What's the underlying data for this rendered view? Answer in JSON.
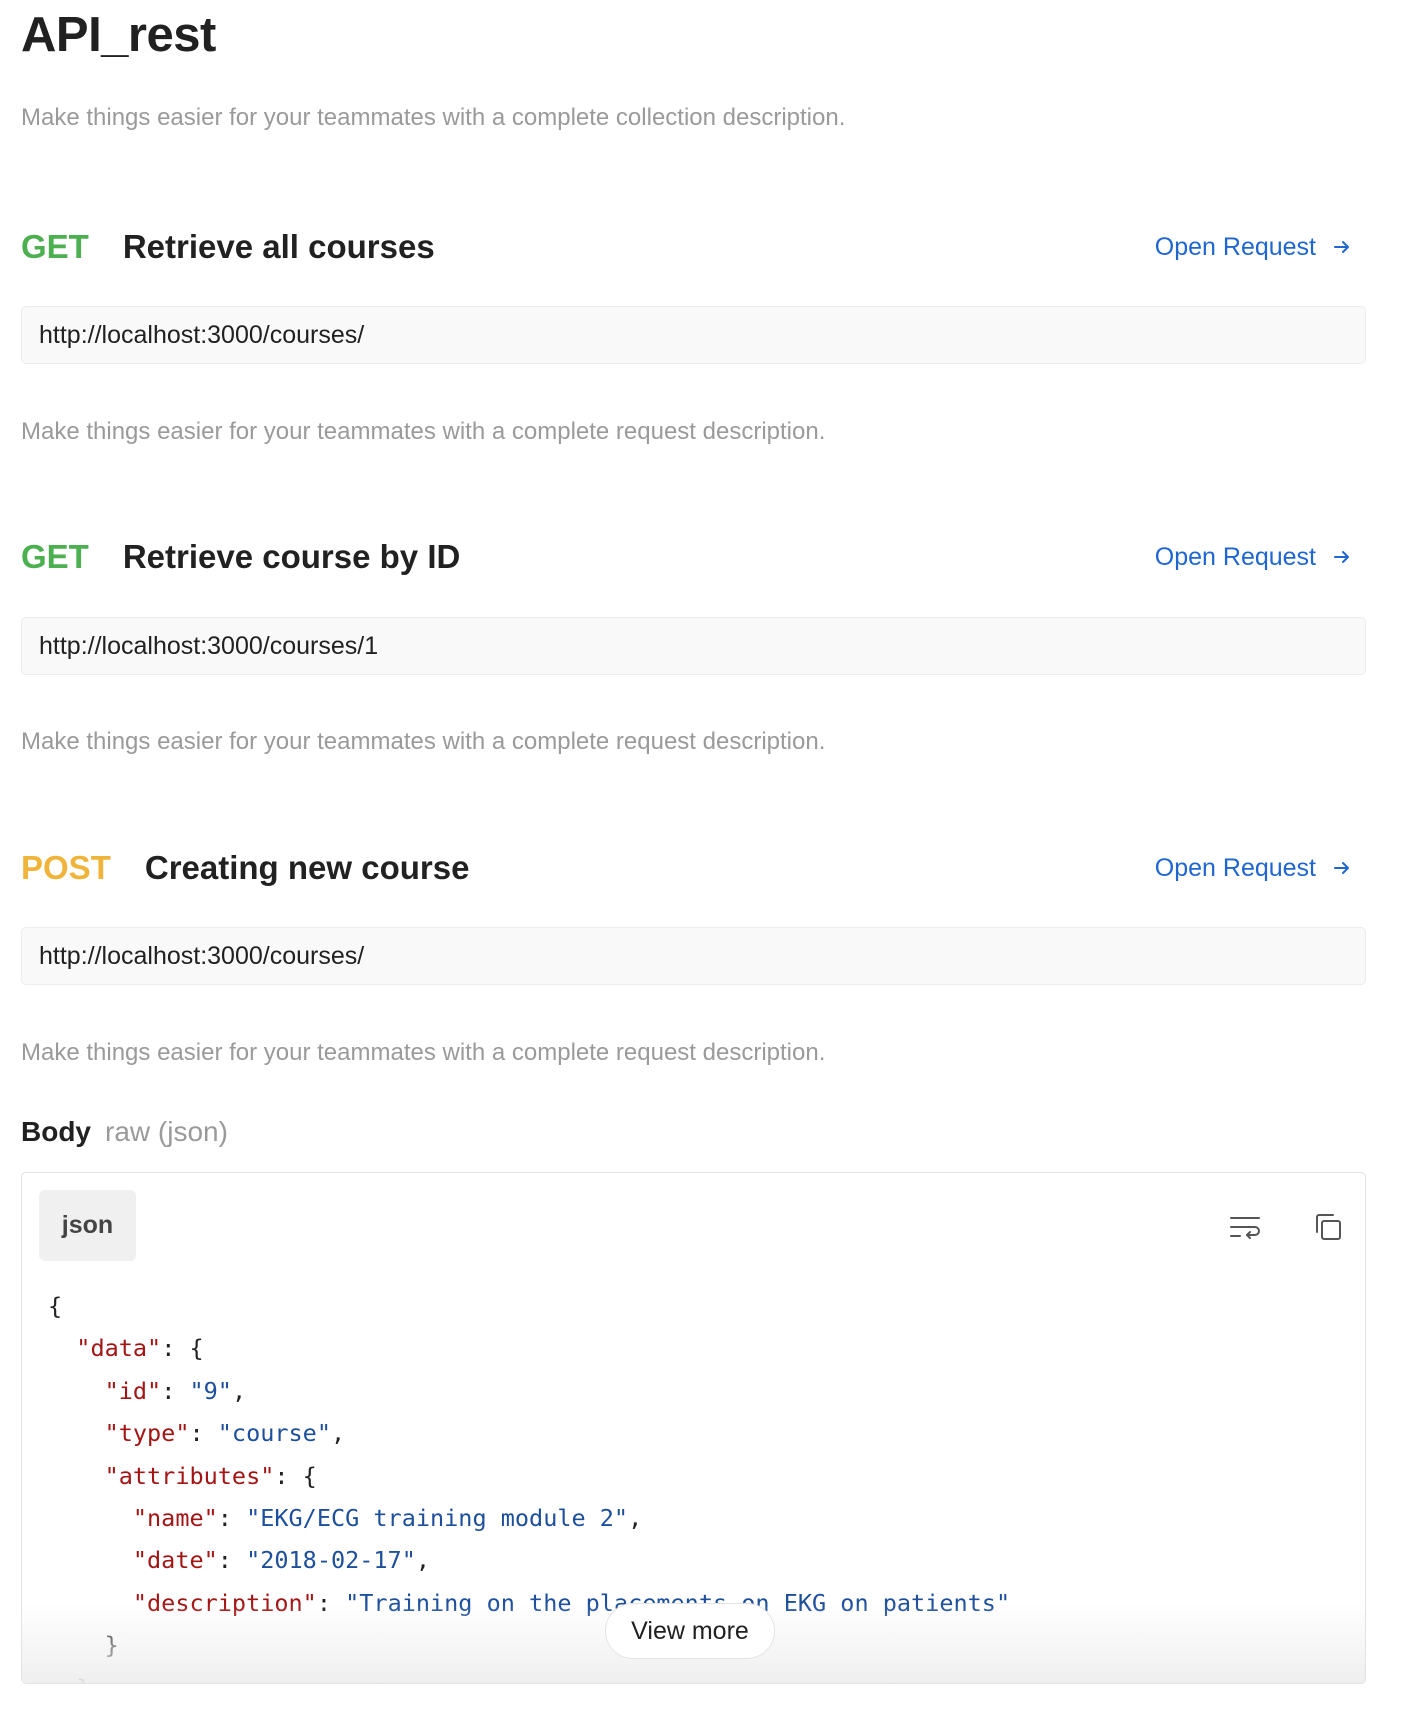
{
  "collection": {
    "title": "API_rest",
    "description": "Make things easier for your teammates with a complete collection description."
  },
  "requests": [
    {
      "method": "GET",
      "name": "Retrieve all courses",
      "open_label": "Open Request",
      "url": "http://localhost:3000/courses/",
      "description": "Make things easier for your teammates with a complete request description."
    },
    {
      "method": "GET",
      "name": "Retrieve course by ID",
      "open_label": "Open Request",
      "url": "http://localhost:3000/courses/1",
      "description": "Make things easier for your teammates with a complete request description."
    },
    {
      "method": "POST",
      "name": "Creating new course",
      "open_label": "Open Request",
      "url": "http://localhost:3000/courses/",
      "description": "Make things easier for your teammates with a complete request description."
    }
  ],
  "body": {
    "label": "Body",
    "mode": "raw (json)",
    "language": "json",
    "wrap_icon": "wrap-lines-icon",
    "copy_icon": "copy-icon",
    "view_more_label": "View more",
    "code": {
      "open_brace": "{",
      "data_key": "\"data\"",
      "id_key": "\"id\"",
      "id_val": "\"9\"",
      "type_key": "\"type\"",
      "type_val": "\"course\"",
      "attributes_key": "\"attributes\"",
      "name_key": "\"name\"",
      "name_val": "\"EKG/ECG training module 2\"",
      "date_key": "\"date\"",
      "date_val": "\"2018-02-17\"",
      "description_key": "\"description\"",
      "description_val": "\"Training on the placements on EKG on patients\"",
      "close_inner": "}",
      "close_outer": "}"
    }
  },
  "colors": {
    "get": "#4caf50",
    "post": "#f0b43a",
    "link": "#1f66d1",
    "json_key": "#a31515",
    "json_string": "#1d4f9c"
  }
}
